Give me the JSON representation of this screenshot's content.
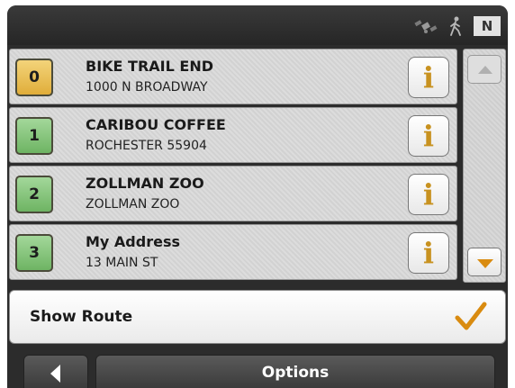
{
  "status_bar": {
    "compass_label": "N",
    "icons": [
      "satellite-icon",
      "walking-person-icon"
    ]
  },
  "list": {
    "items": [
      {
        "number": "0",
        "name": "BIKE TRAIL END",
        "address": "1000 N BROADWAY",
        "color": "#e9bd52"
      },
      {
        "number": "1",
        "name": "CARIBOU COFFEE",
        "address": "ROCHESTER 55904",
        "color": "#86c57b"
      },
      {
        "number": "2",
        "name": "ZOLLMAN ZOO",
        "address": "ZOLLMAN ZOO",
        "color": "#86c57b"
      },
      {
        "number": "3",
        "name": "My Address",
        "address": "13 MAIN ST",
        "color": "#86c57b"
      }
    ],
    "info_glyph": "i"
  },
  "scroll": {
    "up_icon": "chevron-up-icon",
    "down_icon": "chevron-down-icon"
  },
  "show_route": {
    "label": "Show Route",
    "icon": "checkmark-icon"
  },
  "bottom_bar": {
    "back_icon": "back-arrow-icon",
    "options_label": "Options"
  },
  "colors": {
    "accent_orange": "#d98b10",
    "info_gold": "#c89220",
    "header_dark": "#2c2c2c"
  }
}
